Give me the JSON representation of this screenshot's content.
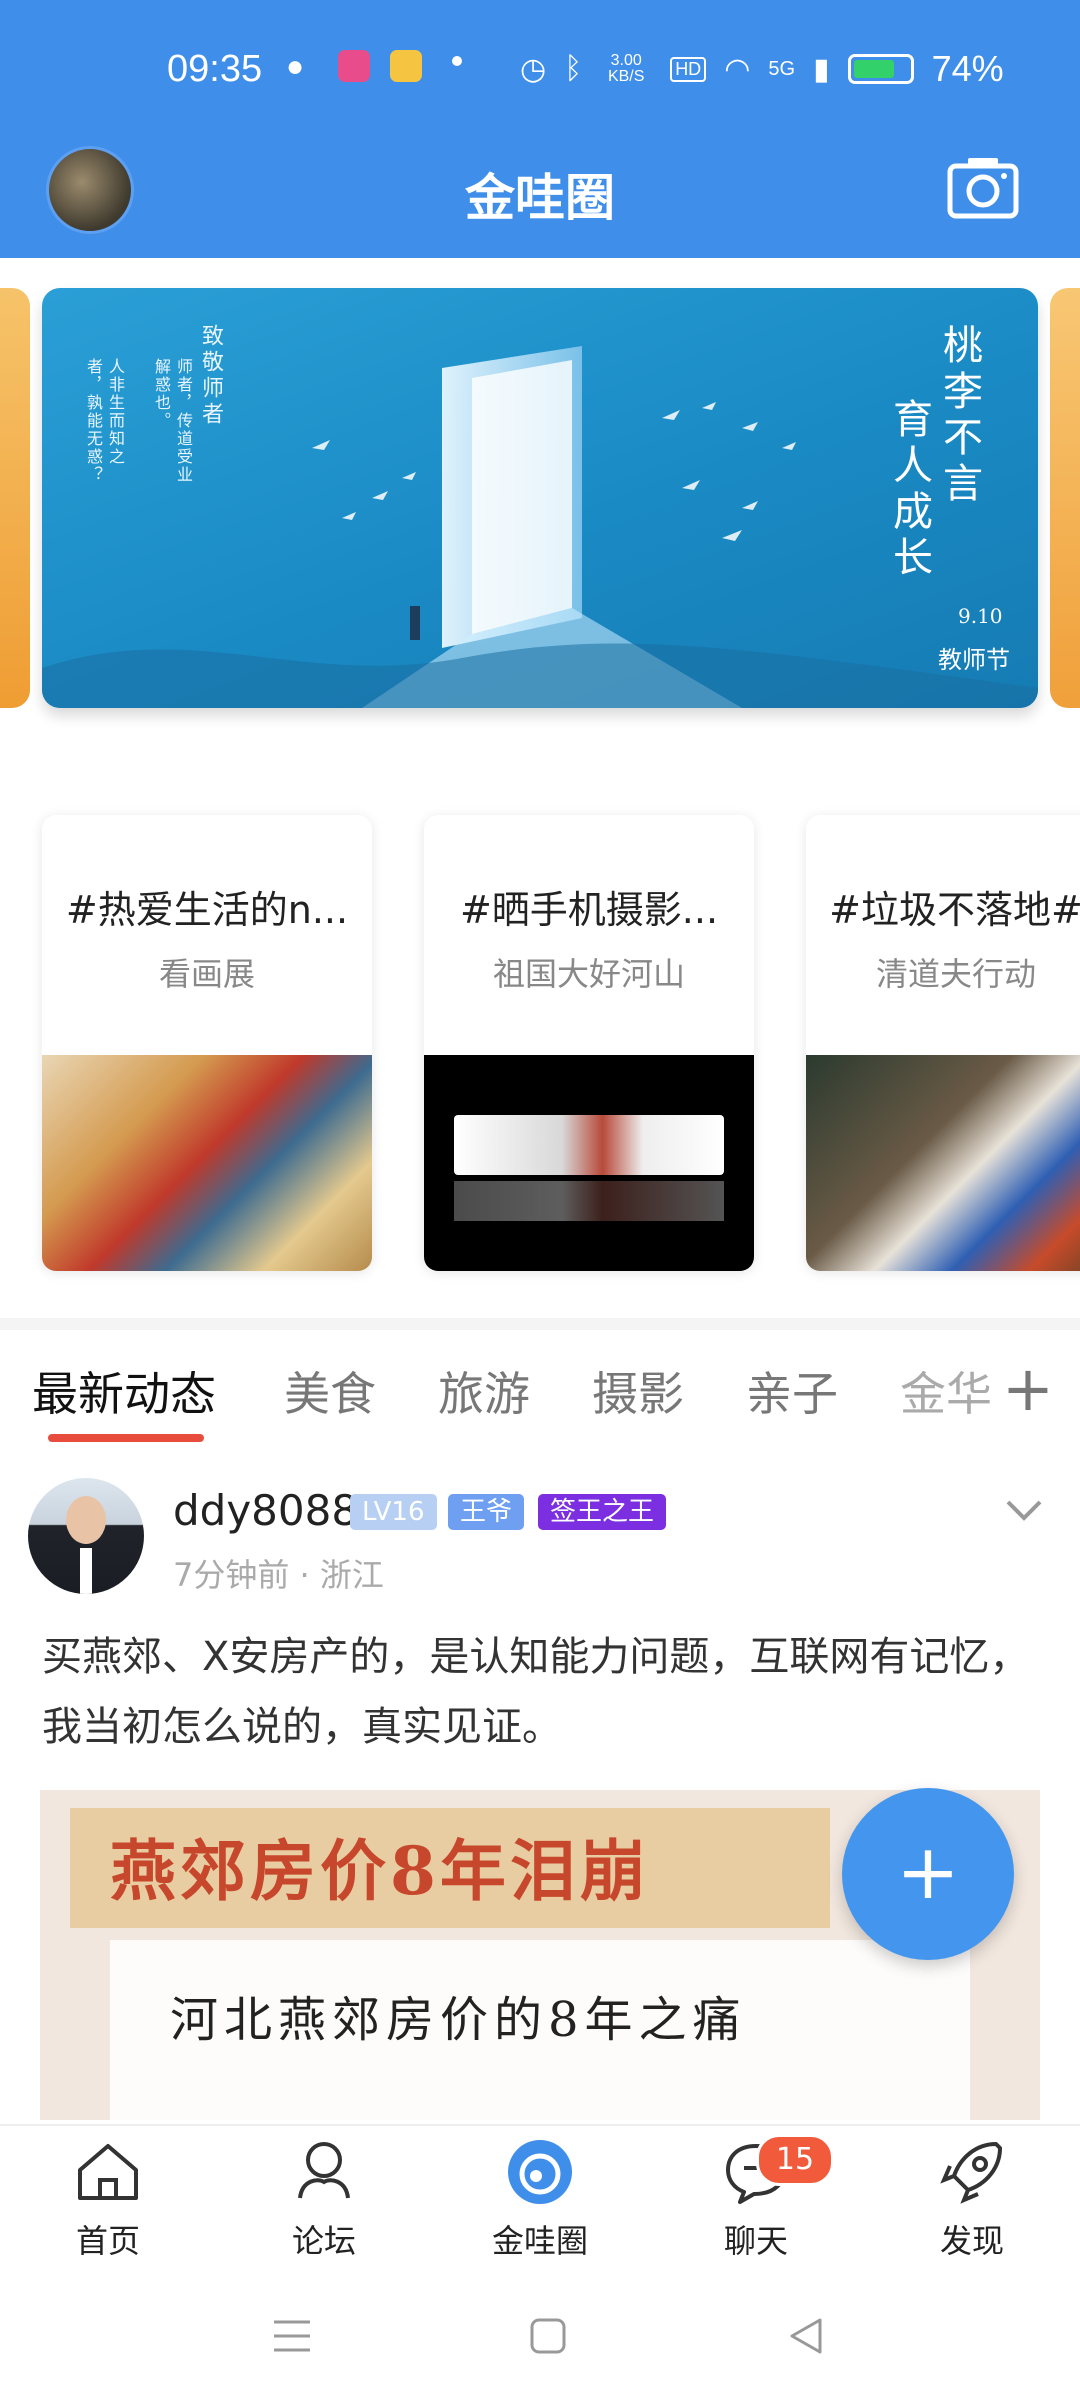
{
  "status_bar": {
    "time": "09:35",
    "net_speed": "3.00 KB/S",
    "network": "5G",
    "battery_pct": "74%",
    "battery_level": 0.74
  },
  "header": {
    "title": "金哇圈",
    "avatar_icon": "user-avatar",
    "camera_icon": "camera-icon"
  },
  "banner": {
    "right_title_1": "桃李不言",
    "right_title_2": "育人成长",
    "left_text_1": "致敬师者",
    "left_text_2": "师者，传道受业解惑也。",
    "left_text_3": "人非生而知之者，孰能无惑？",
    "date": "9.10",
    "event": "教师节"
  },
  "topics": [
    {
      "title": "#热爱生活的n...",
      "subtitle": "看画展"
    },
    {
      "title": "#晒手机摄影...",
      "subtitle": "祖国大好河山"
    },
    {
      "title": "#垃圾不落地#",
      "subtitle": "清道夫行动"
    }
  ],
  "tabs": [
    "最新动态",
    "美食",
    "旅游",
    "摄影",
    "亲子",
    "金华"
  ],
  "tabs_add": "+",
  "post": {
    "username": "ddy8088",
    "badge_level": "LV16",
    "badge_title": "王爷",
    "badge_rank": "签王之王",
    "meta": "7分钟前 · 浙江",
    "text": "买燕郊、X安房产的，是认知能力问题，互联网有记忆，我当初怎么说的，真实见证。",
    "image_headline": "燕郊房价8年泪崩",
    "image_subline": "河北燕郊房价的8年之痛"
  },
  "fab_label": "+",
  "bottom_nav": [
    {
      "label": "首页",
      "icon": "home-icon"
    },
    {
      "label": "论坛",
      "icon": "forum-icon"
    },
    {
      "label": "金哇圈",
      "icon": "circle-icon"
    },
    {
      "label": "聊天",
      "icon": "chat-icon"
    },
    {
      "label": "发现",
      "icon": "rocket-icon"
    }
  ],
  "chat_badge": "15",
  "colors": {
    "accent": "#3f8fea",
    "tab_underline": "#e74c3c",
    "badge_level": "#a9c6f1",
    "badge_title": "#6a9af0",
    "badge_rank": "#7b2fe0"
  }
}
